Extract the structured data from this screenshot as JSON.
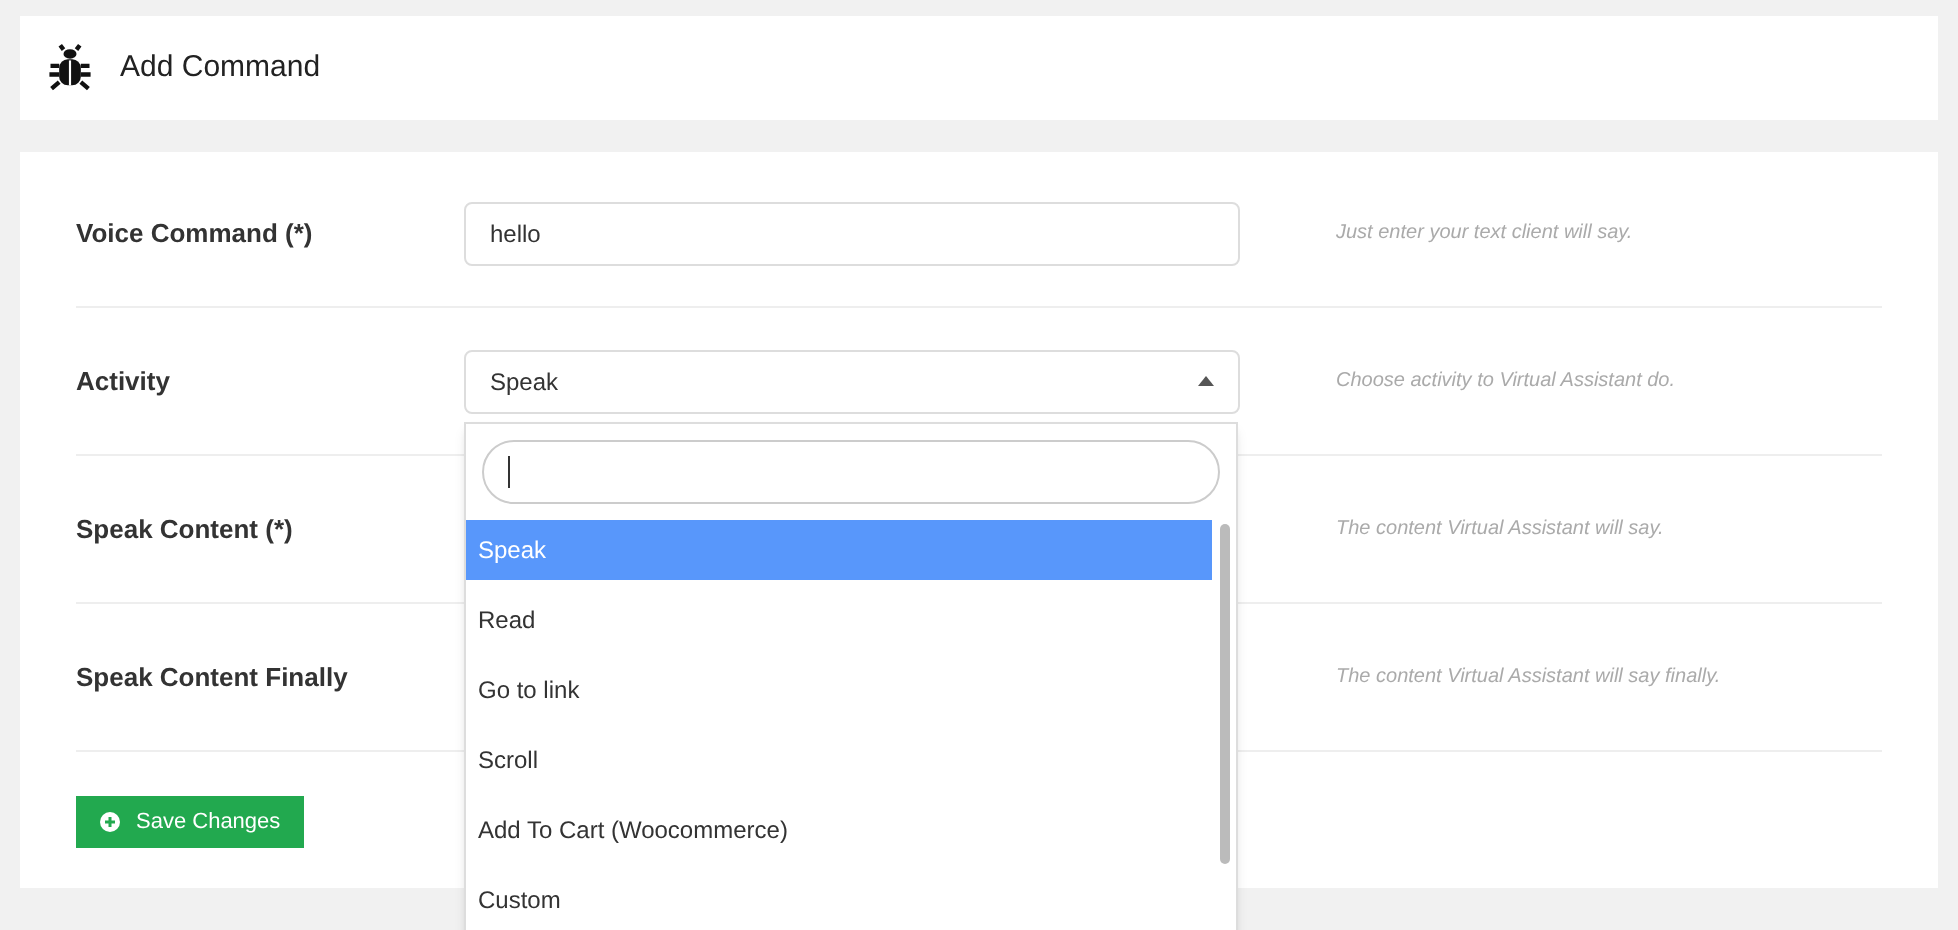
{
  "header": {
    "title": "Add Command"
  },
  "form": {
    "rows": [
      {
        "label": "Voice Command (*)",
        "kind": "input",
        "value": "hello",
        "hint": "Just enter your text client will say."
      },
      {
        "label": "Activity",
        "kind": "select",
        "value": "Speak",
        "hint": "Choose activity to Virtual Assistant do.",
        "expanded": true
      },
      {
        "label": "Speak Content (*)",
        "kind": "covered",
        "hint": "The content Virtual Assistant will say."
      },
      {
        "label": "Speak Content Finally",
        "kind": "covered",
        "hint": "The content Virtual Assistant will say finally."
      }
    ],
    "save_button": "Save Changes"
  },
  "dropdown": {
    "options": [
      {
        "label": "Speak",
        "selected": true
      },
      {
        "label": "Read",
        "selected": false
      },
      {
        "label": "Go to link",
        "selected": false
      },
      {
        "label": "Scroll",
        "selected": false
      },
      {
        "label": "Add To Cart (Woocommerce)",
        "selected": false
      },
      {
        "label": "Custom",
        "selected": false
      }
    ]
  }
}
